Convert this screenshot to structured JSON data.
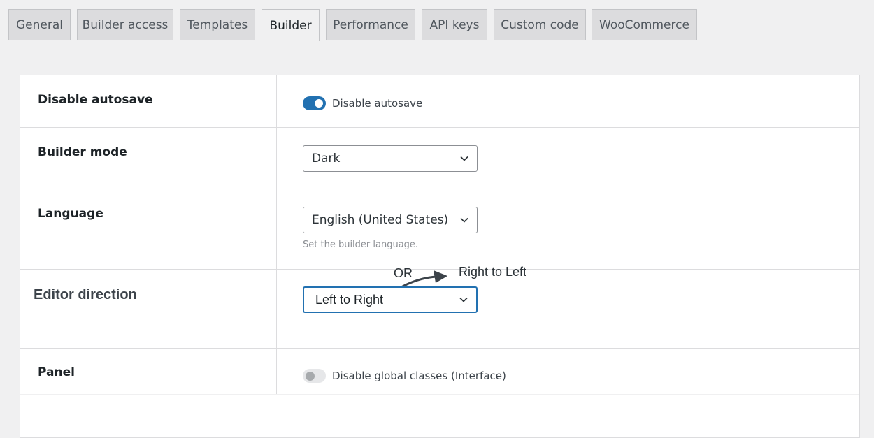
{
  "tabs": [
    {
      "label": "General",
      "active": false
    },
    {
      "label": "Builder access",
      "active": false
    },
    {
      "label": "Templates",
      "active": false
    },
    {
      "label": "Builder",
      "active": true
    },
    {
      "label": "Performance",
      "active": false
    },
    {
      "label": "API keys",
      "active": false
    },
    {
      "label": "Custom code",
      "active": false
    },
    {
      "label": "WooCommerce",
      "active": false
    }
  ],
  "settings": {
    "autosave": {
      "label": "Disable autosave",
      "toggle_label": "Disable autosave",
      "enabled": true
    },
    "builder_mode": {
      "label": "Builder mode",
      "selected": "Dark"
    },
    "language": {
      "label": "Language",
      "selected": "English (United States)",
      "description": "Set the builder language."
    },
    "editor_direction": {
      "label": "Editor direction",
      "selected": "Left to Right",
      "annotation_or": "OR",
      "annotation_alt": "Right to Left"
    },
    "panel": {
      "label": "Panel",
      "toggle_label": "Disable global classes (Interface)",
      "enabled": false
    }
  },
  "icons": {
    "select_arrow": "chevron-down-icon",
    "annotation": "curved-arrow-icon"
  },
  "colors": {
    "accent": "#2271b1",
    "background": "#f0f0f1",
    "panel": "#ffffff",
    "border": "#dcdcde"
  }
}
